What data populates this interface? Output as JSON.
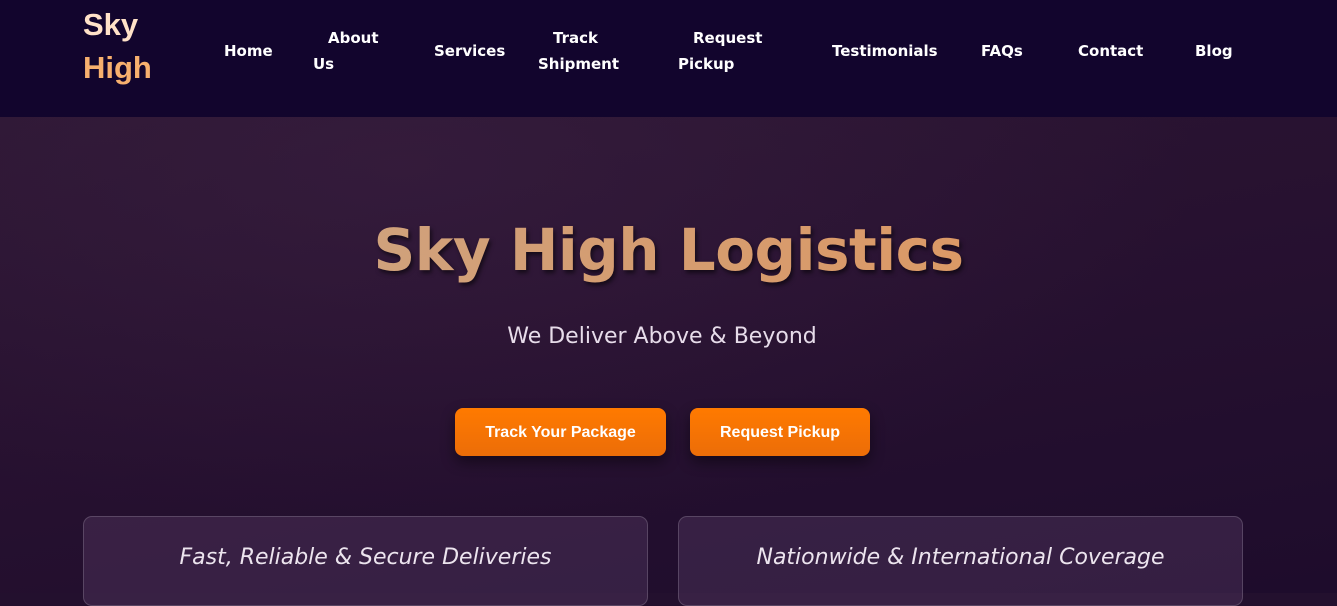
{
  "brand": {
    "line1": "Sky",
    "line2": "High"
  },
  "nav": {
    "home": "Home",
    "about_l1": "About",
    "about_l2": "Us",
    "services": "Services",
    "track_l1": "Track",
    "track_l2": "Shipment",
    "pickup_l1": "Request",
    "pickup_l2": "Pickup",
    "testimonials": "Testimonials",
    "faqs": "FAQs",
    "contact": "Contact",
    "blog": "Blog"
  },
  "hero": {
    "title": "Sky High Logistics",
    "subtitle": "We Deliver Above & Beyond",
    "track_button": "Track Your Package",
    "pickup_button": "Request Pickup"
  },
  "features": [
    {
      "text": "Fast, Reliable & Secure Deliveries"
    },
    {
      "text": "Nationwide & International Coverage"
    }
  ],
  "colors": {
    "nav_background": "#12052d",
    "hero_background": "#271130",
    "accent_orange": "#ff7a00",
    "brand_light": "#ffe2c8",
    "brand_orange": "#f7b06e",
    "title_gold": "#d79a6a"
  }
}
